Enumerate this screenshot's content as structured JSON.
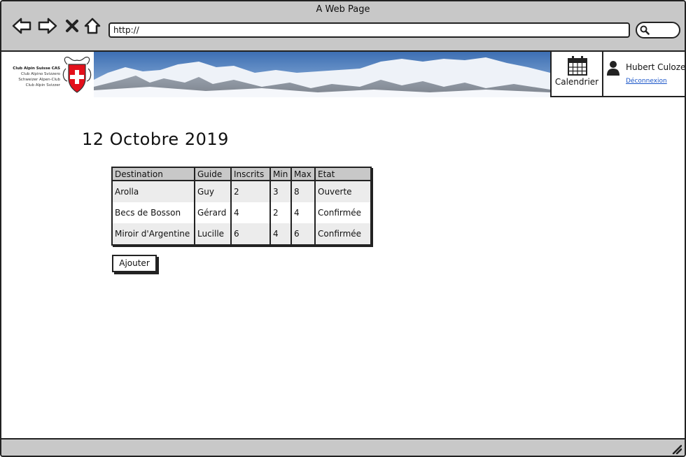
{
  "window": {
    "title": "A Web Page"
  },
  "browser": {
    "url": "http://"
  },
  "header": {
    "logo_lines": [
      "Club Alpin Suisse CAS",
      "Club Alpino Svizzero",
      "Schweizer Alpen-Club",
      "Club Alpin Svizzer"
    ],
    "calendar_label": "Calendrier",
    "user_name": "Hubert Culoze",
    "logout_label": "Déconnexion"
  },
  "main": {
    "title": "12 Octobre 2019",
    "table": {
      "columns": [
        "Destination",
        "Guide",
        "Inscrits",
        "Min",
        "Max",
        "Etat"
      ],
      "rows": [
        [
          "Arolla",
          "Guy",
          "2",
          "3",
          "8",
          "Ouverte"
        ],
        [
          "Becs de Bosson",
          "Gérard",
          "4",
          "2",
          "4",
          "Confirmée"
        ],
        [
          "Miroir d'Argentine",
          "Lucille",
          "6",
          "4",
          "6",
          "Confirmée"
        ]
      ]
    },
    "add_button_label": "Ajouter"
  },
  "colors": {
    "chrome": "#c8c8c8",
    "link": "#1a55c8",
    "row_alt": "#ececec"
  }
}
